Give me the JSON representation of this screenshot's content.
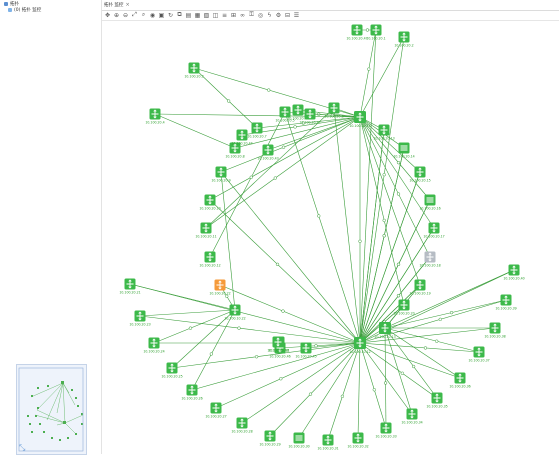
{
  "tree": {
    "root_label": "拓扑",
    "child_label": "(0) 拓扑 监控"
  },
  "tab": {
    "title": "拓扑 监控",
    "close_icon": "close-icon"
  },
  "toolbar": {
    "tools": [
      "pan-icon",
      "zoom-in-icon",
      "zoom-out-icon",
      "zoom-fit-icon",
      "search-icon",
      "view-icon",
      "select-icon",
      "refresh-icon",
      "copy-icon",
      "paste-icon",
      "save-icon",
      "image-icon",
      "layout-icon",
      "align-icon",
      "group-icon",
      "link-icon",
      "lock-icon",
      "visibility-icon",
      "power-icon",
      "settings-icon",
      "grid-icon",
      "properties-icon"
    ]
  },
  "colors": {
    "node_green": "#3cb94a",
    "node_orange": "#f59a3a",
    "node_gray": "#b6bcc4",
    "link": "#3a9d3a",
    "label": "#2a9d2a"
  },
  "nodes": [
    {
      "id": "hub1",
      "label": "10.100.10.11"
    },
    {
      "id": "hub2",
      "label": "10.100.10.12"
    },
    {
      "id": "hub3",
      "label": "10.100.10.13"
    },
    {
      "id": "sw1",
      "label": "10.100.10.21"
    },
    {
      "id": "sw2",
      "label": "10.100.10.22"
    },
    {
      "id": "n01",
      "label": "10.100.20.1"
    },
    {
      "id": "n02",
      "label": "10.100.20.2"
    },
    {
      "id": "n03",
      "label": "10.100.20.3"
    },
    {
      "id": "n04",
      "label": "10.100.20.4"
    },
    {
      "id": "n05",
      "label": "10.100.20.5"
    },
    {
      "id": "n06",
      "label": "10.100.20.6"
    },
    {
      "id": "n07",
      "label": "10.100.20.7"
    },
    {
      "id": "n08",
      "label": "10.100.20.8"
    },
    {
      "id": "n09",
      "label": "10.100.20.9"
    },
    {
      "id": "n10",
      "label": "10.100.20.10"
    },
    {
      "id": "n11",
      "label": "10.100.20.11"
    },
    {
      "id": "n12",
      "label": "10.100.20.12"
    },
    {
      "id": "n13",
      "label": "10.100.20.13"
    },
    {
      "id": "n14",
      "label": "10.100.20.14"
    },
    {
      "id": "n15",
      "label": "10.100.20.15"
    },
    {
      "id": "n16",
      "label": "10.100.20.16"
    },
    {
      "id": "n17",
      "label": "10.100.20.17"
    },
    {
      "id": "n18",
      "label": "10.100.20.18"
    },
    {
      "id": "n19",
      "label": "10.100.20.19"
    },
    {
      "id": "n20",
      "label": "10.100.20.20"
    },
    {
      "id": "n21",
      "label": "10.100.20.21"
    },
    {
      "id": "n22",
      "label": "10.100.20.22"
    },
    {
      "id": "n23",
      "label": "10.100.20.23"
    },
    {
      "id": "n24",
      "label": "10.100.20.24"
    },
    {
      "id": "n25",
      "label": "10.100.20.25"
    },
    {
      "id": "n26",
      "label": "10.100.20.26"
    },
    {
      "id": "n27",
      "label": "10.100.20.27"
    },
    {
      "id": "n28",
      "label": "10.100.20.28"
    },
    {
      "id": "n29",
      "label": "10.100.20.29"
    },
    {
      "id": "n30",
      "label": "10.100.20.30"
    },
    {
      "id": "n31",
      "label": "10.100.20.31"
    },
    {
      "id": "n32",
      "label": "10.100.20.32"
    },
    {
      "id": "n33",
      "label": "10.100.20.33"
    },
    {
      "id": "n34",
      "label": "10.100.20.34"
    },
    {
      "id": "n35",
      "label": "10.100.20.35"
    },
    {
      "id": "n36",
      "label": "10.100.20.36"
    },
    {
      "id": "n37",
      "label": "10.100.20.37"
    },
    {
      "id": "n38",
      "label": "10.100.20.38"
    },
    {
      "id": "n39",
      "label": "10.100.20.39"
    },
    {
      "id": "n40",
      "label": "10.100.20.40"
    },
    {
      "id": "n41",
      "label": "10.100.20.41"
    },
    {
      "id": "n42",
      "label": "10.100.20.42"
    },
    {
      "id": "n43",
      "label": "10.100.20.43"
    },
    {
      "id": "n44",
      "label": "10.100.20.44"
    },
    {
      "id": "n45",
      "label": "10.100.20.45"
    },
    {
      "id": "n46",
      "label": "10.100.20.46"
    },
    {
      "id": "n47",
      "label": "10.100.20.47"
    },
    {
      "id": "n48",
      "label": "10.100.20.48"
    }
  ]
}
